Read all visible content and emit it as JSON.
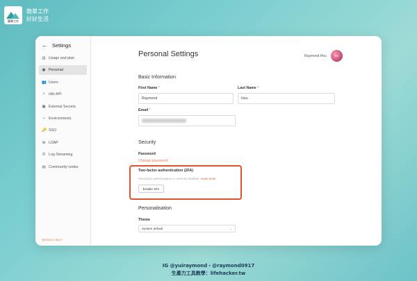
{
  "brand": {
    "line1": "簡單工作",
    "line2": "好好生活",
    "logo_caption": "簡單工作"
  },
  "sidebar": {
    "title": "Settings",
    "items": [
      {
        "icon": "▥",
        "label": "Usage and plan"
      },
      {
        "icon": "●",
        "label": "Personal"
      },
      {
        "icon": "👥",
        "label": "Users"
      },
      {
        "icon": "⚡",
        "label": "n8n API"
      },
      {
        "icon": "▣",
        "label": "External Secrets"
      },
      {
        "icon": "⑂",
        "label": "Environments"
      },
      {
        "icon": "🔑",
        "label": "SSO"
      },
      {
        "icon": "⊞",
        "label": "LDAP"
      },
      {
        "icon": "☰",
        "label": "Log Streaming"
      },
      {
        "icon": "▤",
        "label": "Community nodes"
      }
    ],
    "version": "Version 1.63.2"
  },
  "page": {
    "title": "Personal Settings"
  },
  "user": {
    "name": "Raymond Hou",
    "initials": "RH"
  },
  "basic": {
    "section": "Basic Information",
    "first_name_label": "First Name",
    "first_name_value": "Raymond",
    "last_name_label": "Last Name",
    "last_name_value": "Hou",
    "email_label": "Email",
    "required_mark": "*"
  },
  "security": {
    "section": "Security",
    "password_label": "Password",
    "change_password": "Change password",
    "tfa_title": "Two-factor authentication (2FA)",
    "tfa_desc": "Two-factor authentication is currently disabled.",
    "learn_more": "Learn more",
    "enable_button": "Enable 2FA"
  },
  "personalisation": {
    "section": "Personalisation",
    "theme_label": "Theme",
    "theme_value": "System default"
  },
  "footer": {
    "line1": "IG @yuiraymond・@raymond0917",
    "line2": "生產力工具教學：lifehacker.tw"
  },
  "colors": {
    "accent": "#f07a4a",
    "highlight_border": "#e0502a"
  }
}
